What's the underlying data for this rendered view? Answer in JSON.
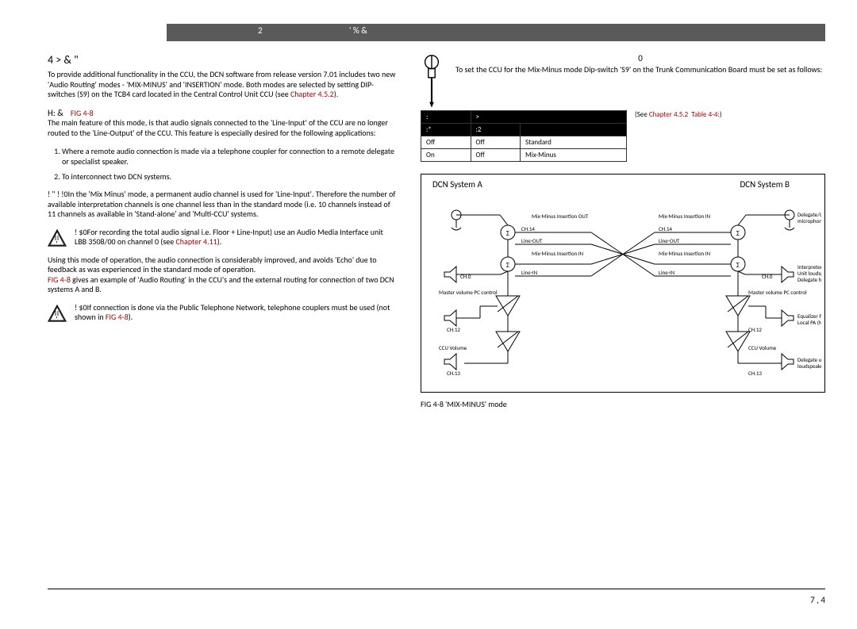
{
  "header": {
    "left_num": "2",
    "right_text": "' %  &"
  },
  "section_title": "4 >     & \"",
  "intro": "To provide additional functionality in the CCU, the  DCN software from release version 7.01 includes two new 'Audio Routing' modes - 'MIX-MINUS' and 'INSERTION' mode. Both modes are selected by setting DIP-switches (S9)  on the TCB4 card located in the Central Control Unit CCU (see ",
  "intro_ref": "Chapter 4.5.2",
  "intro_end": ").",
  "mode_label": "H:     &",
  "mode_fig": "FIG 4-8",
  "mode_text": "The main feature of this mode, is that audio signals connected to the 'Line-Input' of the CCU are no longer routed to the 'Line-Output' of the CCU. This feature is especially desired for the following applications:",
  "list1": "Where a remote audio connection is made via a telephone coupler for connection to a remote delegate or specialist speaker.",
  "list2": "To interconnect two DCN systems.",
  "after_list_label": "! \"   ! !0",
  "after_list_text": "In the 'Mix Minus' mode, a permanent audio channel is used for 'Line-Input'. Therefore the number of available interpretation channels is one channel less than in the standard mode (i.e. 10 channels instead of 11 channels as available in 'Stand-alone' and 'Multi-CCU' systems.",
  "note1_label": "! $0",
  "note1_text": "For recording the total audio signal i.e. Floor + Line-Input) use an Audio Media Interface unit LBB 3508/00 on channel 0 (see ",
  "note1_ref": "Chapter 4.11",
  "note1_end": ").",
  "echo_text": "Using this mode of operation, the audio connection is considerably improved, and avoids 'Echo' due to feedback as was experienced in the standard mode of operation.",
  "echo_ref": "FIG 4-8",
  "echo_text2": " gives an example of 'Audio Routing' in the CCU's and the external routing for connection of two DCN systems A and B.",
  "note2_label": "! $0",
  "note2_text": "If connection is done via the Public Telephone Network, telephone couplers must be used (not shown in ",
  "note2_ref": "FIG 4-8",
  "note2_end": ").",
  "setup_label": "0",
  "setup_text": "To set the CCU for the Mix-Minus mode Dip-switch 'S9' on the Trunk Communication Board must be set as follows:",
  "see_text": "(See ",
  "see_ref1": "Chapter 4.5.2",
  "see_ref2": "Table 4-4:",
  "see_end": ")",
  "table": {
    "top_left": ":",
    "top_right": ">",
    "sub1": ":*",
    "sub2": ":2",
    "sub3": "",
    "rows": [
      {
        "c1": "Off",
        "c2": "Off",
        "c3": "Standard"
      },
      {
        "c1": "On",
        "c2": "Off",
        "c3": "Mix-Minus"
      }
    ]
  },
  "diagram": {
    "sysA": "DCN System A",
    "sysB": "DCN System B",
    "lbl_mixminus_out": "Mix-Minus Insertion OUT",
    "lbl_mixminus_in": "Mix-Minus Insertion IN",
    "lbl_ch14": "CH.14",
    "lbl_lineout": "Line-OUT",
    "lbl_linein": "Line-IN",
    "lbl_ch0": "CH.0",
    "lbl_master": "Master volume PC control",
    "lbl_ch12": "CH.12",
    "lbl_ccuvol": "CCU Volume",
    "lbl_ch13": "CH.13",
    "lbl_delchair": "Delegate/Chairman microphones",
    "lbl_interp": "Interpreter headphones Unit loudspeaker Delegate headphones",
    "lbl_eq": "Equalizer PA Local PA (MCCU)",
    "lbl_delunit": "Delegate unit loudspeaker"
  },
  "caption": "FIG 4-8   'MIX-MINUS' mode",
  "page": "7 ,   4"
}
